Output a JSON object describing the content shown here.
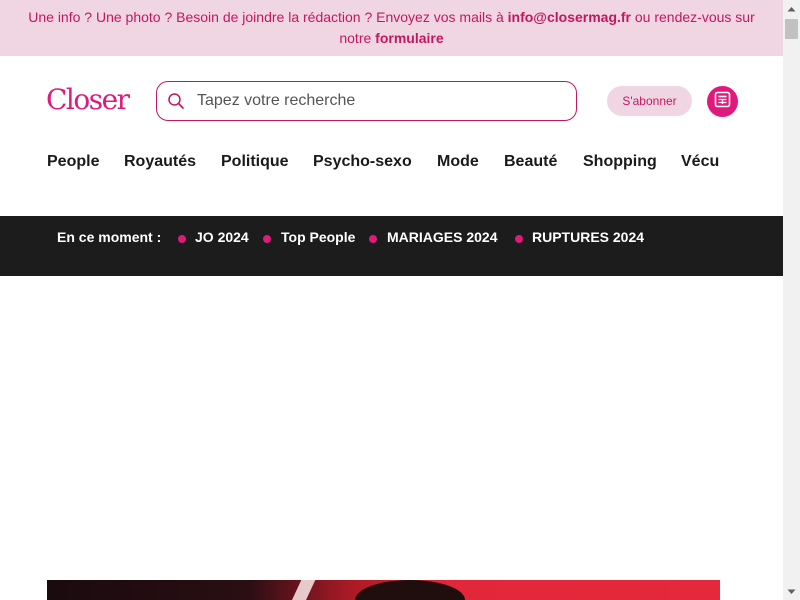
{
  "banner": {
    "text_before": "Une info ? Une photo ? Besoin de joindre la rédaction ? Envoyez vos mails à ",
    "email": "info@closermag.fr",
    "text_middle": " ou rendez-vous sur notre ",
    "form_link": "formulaire"
  },
  "header": {
    "logo": "Closer",
    "search": {
      "placeholder": "Tapez votre recherche",
      "value": ""
    },
    "subscribe_label": "S'abonner",
    "magazine_icon": "newspaper-icon"
  },
  "nav": {
    "items": [
      {
        "label": "People"
      },
      {
        "label": "Royautés"
      },
      {
        "label": "Politique"
      },
      {
        "label": "Psycho-sexo"
      },
      {
        "label": "Mode"
      },
      {
        "label": "Beauté"
      },
      {
        "label": "Shopping"
      },
      {
        "label": "Vécu"
      }
    ]
  },
  "trending": {
    "label": "En ce moment :",
    "items": [
      {
        "label": "JO 2024"
      },
      {
        "label": "Top People"
      },
      {
        "label": "MARIAGES 2024"
      },
      {
        "label": "RUPTURES 2024"
      }
    ]
  },
  "colors": {
    "brand_pink": "#e0197c",
    "banner_bg": "#f0d6e3",
    "trending_bg": "#1c1c1c"
  }
}
